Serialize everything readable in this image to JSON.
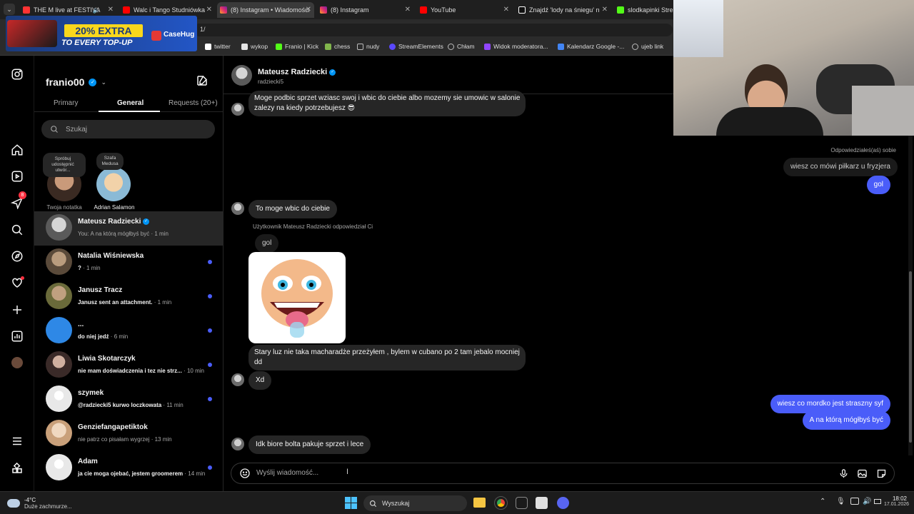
{
  "browser": {
    "tabs": [
      {
        "title": "THE M live at FESTIVA",
        "color": "#ff3333"
      },
      {
        "title": "Walc i Tango Studniówka",
        "color": "#ff0000"
      },
      {
        "title": "(8) Instagram • Wiadomości",
        "color": "#e1306c"
      },
      {
        "title": "(8) Instagram",
        "color": "#e1306c"
      },
      {
        "title": "YouTube",
        "color": "#ff0000"
      },
      {
        "title": "Znajdź 'lody na śniegu' n",
        "color": "#ffffff"
      },
      {
        "title": "slodkapinki Stream",
        "color": "#53fc18"
      }
    ],
    "url_fragment": "1/",
    "bookmarks": [
      {
        "label": "twitter",
        "color": "#ffffff"
      },
      {
        "label": "wykop",
        "color": "#e5e5e5"
      },
      {
        "label": "Franio | Kick",
        "color": "#53fc18"
      },
      {
        "label": "chess",
        "color": "#81b64c"
      },
      {
        "label": "nudy",
        "color": "#bbbbbb"
      },
      {
        "label": "StreamElements",
        "color": "#5a48ff"
      },
      {
        "label": "Chłam",
        "color": "#bbbbbb"
      },
      {
        "label": "Widok moderatora...",
        "color": "#9146ff"
      },
      {
        "label": "Kalendarz Google -...",
        "color": "#4285f4"
      },
      {
        "label": "ujeb link",
        "color": "#bbbbbb"
      }
    ],
    "ad": {
      "headline": "20% EXTRA",
      "subline": "TO EVERY TOP-UP",
      "brand": "CaseHug"
    }
  },
  "sidebar": {
    "username": "franio00",
    "tabs": [
      "Primary",
      "General",
      "Requests (20+)"
    ],
    "active_tab": "General",
    "search_placeholder": "Szukaj",
    "notes": [
      {
        "note": "Spróbuj udostępnić utwór...",
        "caption": "Twoja notatka"
      },
      {
        "note": "Szafa Medusa",
        "caption": "Adrian Salamon"
      }
    ],
    "notification_count": "8",
    "conversations": [
      {
        "name": "Mateusz Radziecki",
        "verified": true,
        "preview": "You: A na którą mógłbyś być",
        "time": "1 min",
        "unread": false,
        "avatar": "#5a5a5a"
      },
      {
        "name": "Natalia Wiśniewska",
        "verified": false,
        "preview": "?",
        "time": "1 min",
        "unread": true,
        "avatar": "#7a6a55"
      },
      {
        "name": "Janusz Tracz",
        "verified": false,
        "preview": "Janusz sent an attachment.",
        "time": "1 min",
        "unread": true,
        "avatar": "#8a7a5a"
      },
      {
        "name": "...",
        "verified": false,
        "preview": "do niej jedź",
        "time": "6 min",
        "unread": true,
        "avatar": "#2e88e6"
      },
      {
        "name": "Liwia Skotarczyk",
        "verified": false,
        "preview": "nie mam doświadczenia i tez nie strz...",
        "time": "10 min",
        "unread": true,
        "avatar": "#6a5a50"
      },
      {
        "name": "szymek",
        "verified": false,
        "preview": "@radziecki5 kurwo loczkowata",
        "time": "11 min",
        "unread": true,
        "avatar": "#e8e8e8"
      },
      {
        "name": "Genziefangapetiktok",
        "verified": false,
        "preview": "nie patrz co pisałam wygrzej",
        "time": "13 min",
        "unread": false,
        "avatar": "#c9b49a"
      },
      {
        "name": "Adam",
        "verified": false,
        "preview": "ja cie moga ojebać, jestem groomerem",
        "time": "14 min",
        "unread": true,
        "avatar": "#e8e8e8"
      }
    ]
  },
  "chat": {
    "contact_name": "Mateusz Radziecki",
    "contact_handle": "radziecki5",
    "messages_in_1": "Moge podbic sprzet wziasc swoj i wbic do ciebie albo mozemy sie umowic w salonie",
    "messages_in_1b": "zalezy na kiedy potrzebujesz 😎",
    "reply_label": "Odpowiedziałeś(aś) sobie",
    "out_1": "wiesz co mówi piłkarz u fryzjera",
    "out_2": "gol",
    "in_2": "To moge wbic do ciebie",
    "in_reply_label": "Użytkownik Mateusz Radziecki odpowiedział Ci",
    "in_quote": "gol",
    "in_3a": "Stary luz nie taka macharadże przeżyłem , bylem w cubano po 2 tam jebalo mocniej",
    "in_3b": "dd",
    "in_4": "Xd",
    "out_3": "wiesz co mordko jest straszny syf",
    "out_4": "A na którą mógłbyś być",
    "in_5": "Idk biore bolta pakuje sprzet i lece",
    "composer_placeholder": "Wyślij wiadomość..."
  },
  "taskbar": {
    "weather_temp": "-4°C",
    "weather_desc": "Duże zachmurze...",
    "search_placeholder": "Wyszukaj",
    "time": "18:02",
    "date": "17.01.2026"
  }
}
